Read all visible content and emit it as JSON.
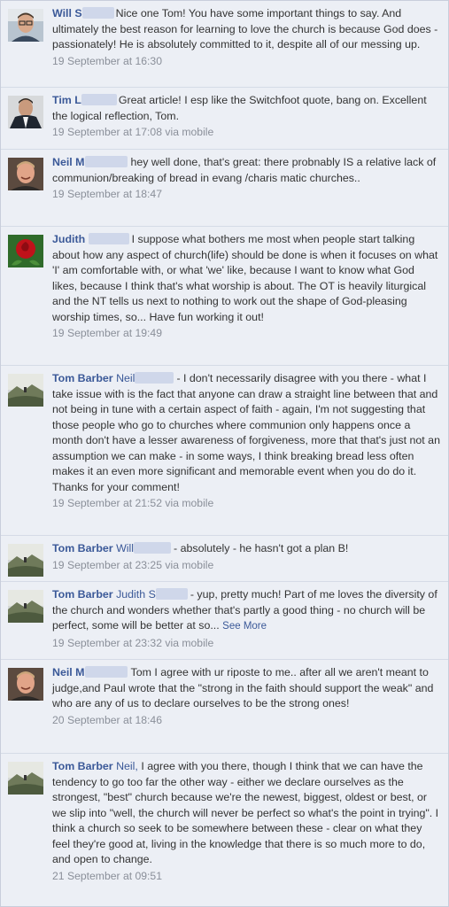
{
  "comments": [
    {
      "author": "Will S",
      "mention": "",
      "text": "Nice one Tom! You have some important things to say. And ultimately the best reason for learning to love the church is because God does - passionately! He is absolutely committed to it, despite all of our messing up.",
      "timestamp": "19 September at 16:30",
      "via": "",
      "see_more": "",
      "avatar": "man-in-glasses-avatar"
    },
    {
      "author": "Tim L",
      "mention": "",
      "text": "Great article! I esp like the Switchfoot quote, bang on. Excellent the logical reflection, Tom.",
      "timestamp": "19 September at 17:08",
      "via": "via mobile",
      "see_more": "",
      "avatar": "man-in-suit-avatar"
    },
    {
      "author": "Neil M",
      "mention": "",
      "text": "hey well done, that's great: there probnably IS a relative lack of communion/breaking of bread in evang /charis matic churches..",
      "timestamp": "19 September at 18:47",
      "via": "",
      "see_more": "",
      "avatar": "smiling-man-avatar"
    },
    {
      "author": "Judith",
      "mention": "",
      "text": "I suppose what bothers me most when people start talking about how any aspect of church(life) should be done is when it focuses on what 'I' am comfortable with, or what 'we' like, because I want to know what God likes, because I think that's what worship is about. The OT is heavily liturgical and the NT tells us next to nothing to work out the shape of God-pleasing worship times, so... Have fun working it out!",
      "timestamp": "19 September at 19:49",
      "via": "",
      "see_more": "",
      "avatar": "red-rose-avatar"
    },
    {
      "author": "Tom Barber",
      "mention": "Neil",
      "text": "- I don't necessarily disagree with you there - what I take issue with is the fact that anyone can draw a straight line between that and not being in tune with a certain aspect of faith - again, I'm not suggesting that those people who go to churches where communion only happens once a month don't have a lesser awareness of forgiveness, more that that's just not an assumption we can make - in some ways, I think breaking bread less often makes it an even more significant and memorable event when you do do it. Thanks for your comment!",
      "timestamp": "19 September at 21:52",
      "via": "via mobile",
      "see_more": "",
      "avatar": "landscape-avatar"
    },
    {
      "author": "Tom Barber",
      "mention": "Will",
      "text": "- absolutely - he hasn't got a plan B!",
      "timestamp": "19 September at 23:25",
      "via": "via mobile",
      "see_more": "",
      "avatar": "landscape-avatar"
    },
    {
      "author": "Tom Barber",
      "mention": "Judith S",
      "text": "- yup, pretty much! Part of me loves the diversity of the church and wonders whether that's partly a good thing - no church will be perfect, some will be better at so...",
      "timestamp": "19 September at 23:32",
      "via": "via mobile",
      "see_more": "See More",
      "avatar": "landscape-avatar"
    },
    {
      "author": "Neil M",
      "mention": "",
      "text": "Tom I agree with ur riposte to me.. after all we aren't meant to judge,and Paul wrote that the \"strong in the faith should support the weak\" and who are any of us to declare ourselves to be the strong ones!",
      "timestamp": "20 September at 18:46",
      "via": "",
      "see_more": "",
      "avatar": "smiling-man-avatar"
    },
    {
      "author": "Tom Barber",
      "mention": "Neil,",
      "text": "I agree with you there, though I think that we can have the tendency to go too far the other way - either we declare ourselves as the strongest, \"best\" church because we're the newest, biggest, oldest or best, or we slip into \"well, the church will never be perfect so what's the point in trying\". I think a church so seek to be somewhere between these - clear on what they feel they're good at, living in the knowledge that there is so much more to do, and open to change.",
      "timestamp": "21 September at 09:51",
      "via": "",
      "see_more": "",
      "avatar": "landscape-avatar"
    }
  ],
  "colors": {
    "link": "#3b5998",
    "meta": "#8a8f99",
    "background": "#eceff5",
    "divider": "#d5dbe6"
  }
}
